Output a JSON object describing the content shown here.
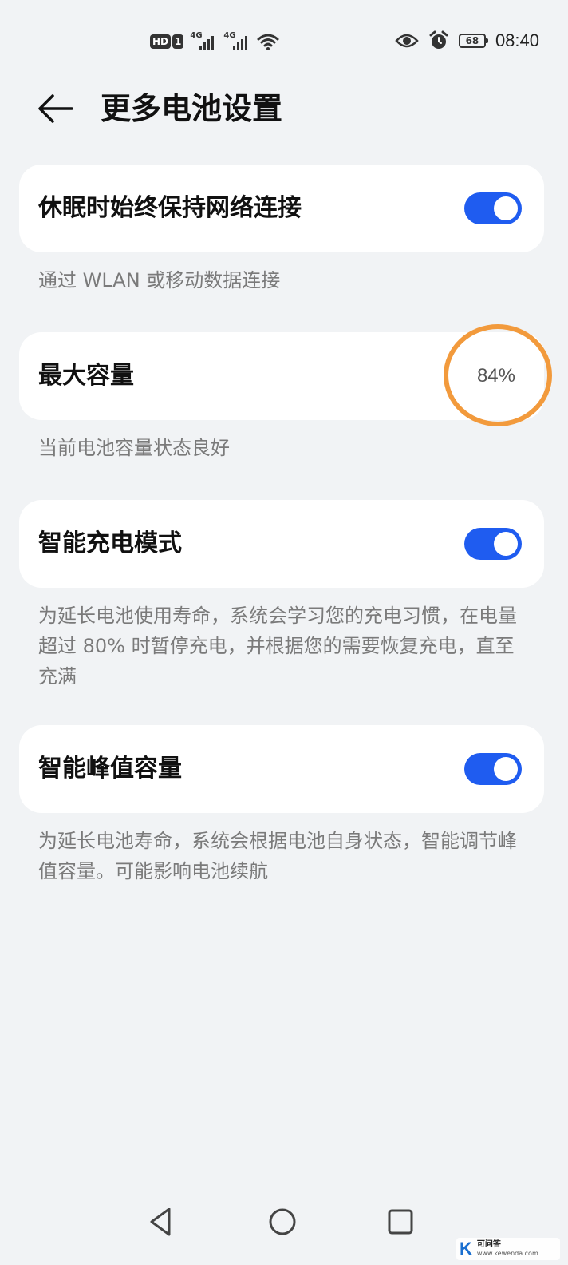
{
  "status_bar": {
    "hd_label": "HD",
    "sim_label": "1",
    "network_1": "4G",
    "network_2": "4G",
    "battery_level": "68",
    "time": "08:40",
    "icons": [
      "signal-icon",
      "wifi-icon",
      "eye-icon",
      "alarm-icon",
      "battery-icon"
    ]
  },
  "header": {
    "title": "更多电池设置",
    "back_icon": "back-arrow-icon"
  },
  "settings": [
    {
      "label": "休眠时始终保持网络连接",
      "toggle_on": true,
      "description": "通过 WLAN 或移动数据连接"
    },
    {
      "label": "最大容量",
      "value": "84%",
      "description": "当前电池容量状态良好"
    },
    {
      "label": "智能充电模式",
      "toggle_on": true,
      "description": "为延长电池使用寿命，系统会学习您的充电习惯，在电量超过 80% 时暂停充电，并根据您的需要恢复充电，直至充满"
    },
    {
      "label": "智能峰值容量",
      "toggle_on": true,
      "description": "为延长电池寿命，系统会根据电池自身状态，智能调节峰值容量。可能影响电池续航"
    }
  ],
  "nav_bar": {
    "icons": [
      "back-triangle-icon",
      "home-circle-icon",
      "recents-square-icon"
    ]
  },
  "watermark": {
    "logo_letter": "K",
    "site_name": "可问答",
    "url": "www.kewenda.com"
  },
  "colors": {
    "toggle_on": "#1f5cf0",
    "background": "#f1f3f5",
    "card": "#ffffff",
    "highlight": "#f29a3c"
  }
}
